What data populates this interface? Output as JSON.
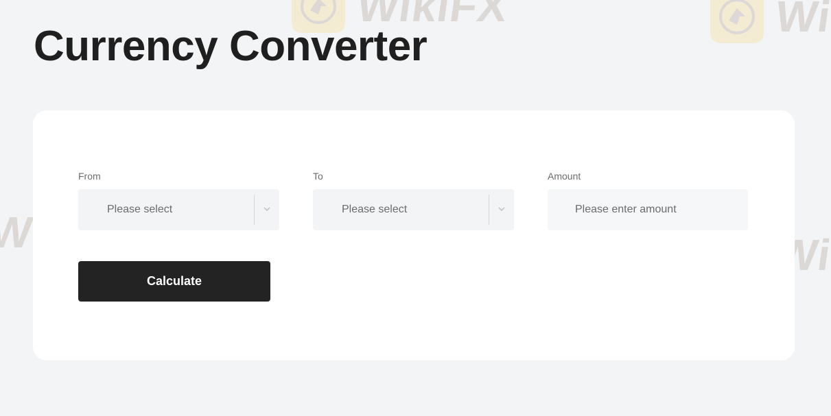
{
  "page": {
    "title": "Currency Converter"
  },
  "watermark": {
    "text": "WikiFX",
    "icon": "eagle-logo-icon"
  },
  "form": {
    "from": {
      "label": "From",
      "value": "Please select"
    },
    "to": {
      "label": "To",
      "value": "Please select"
    },
    "amount": {
      "label": "Amount",
      "placeholder": "Please enter amount",
      "value": ""
    },
    "calculate_label": "Calculate"
  },
  "colors": {
    "background": "#f3f4f6",
    "card": "#ffffff",
    "button": "#232323",
    "button_text": "#ffffff",
    "watermark_logo": "#f5d35a"
  }
}
